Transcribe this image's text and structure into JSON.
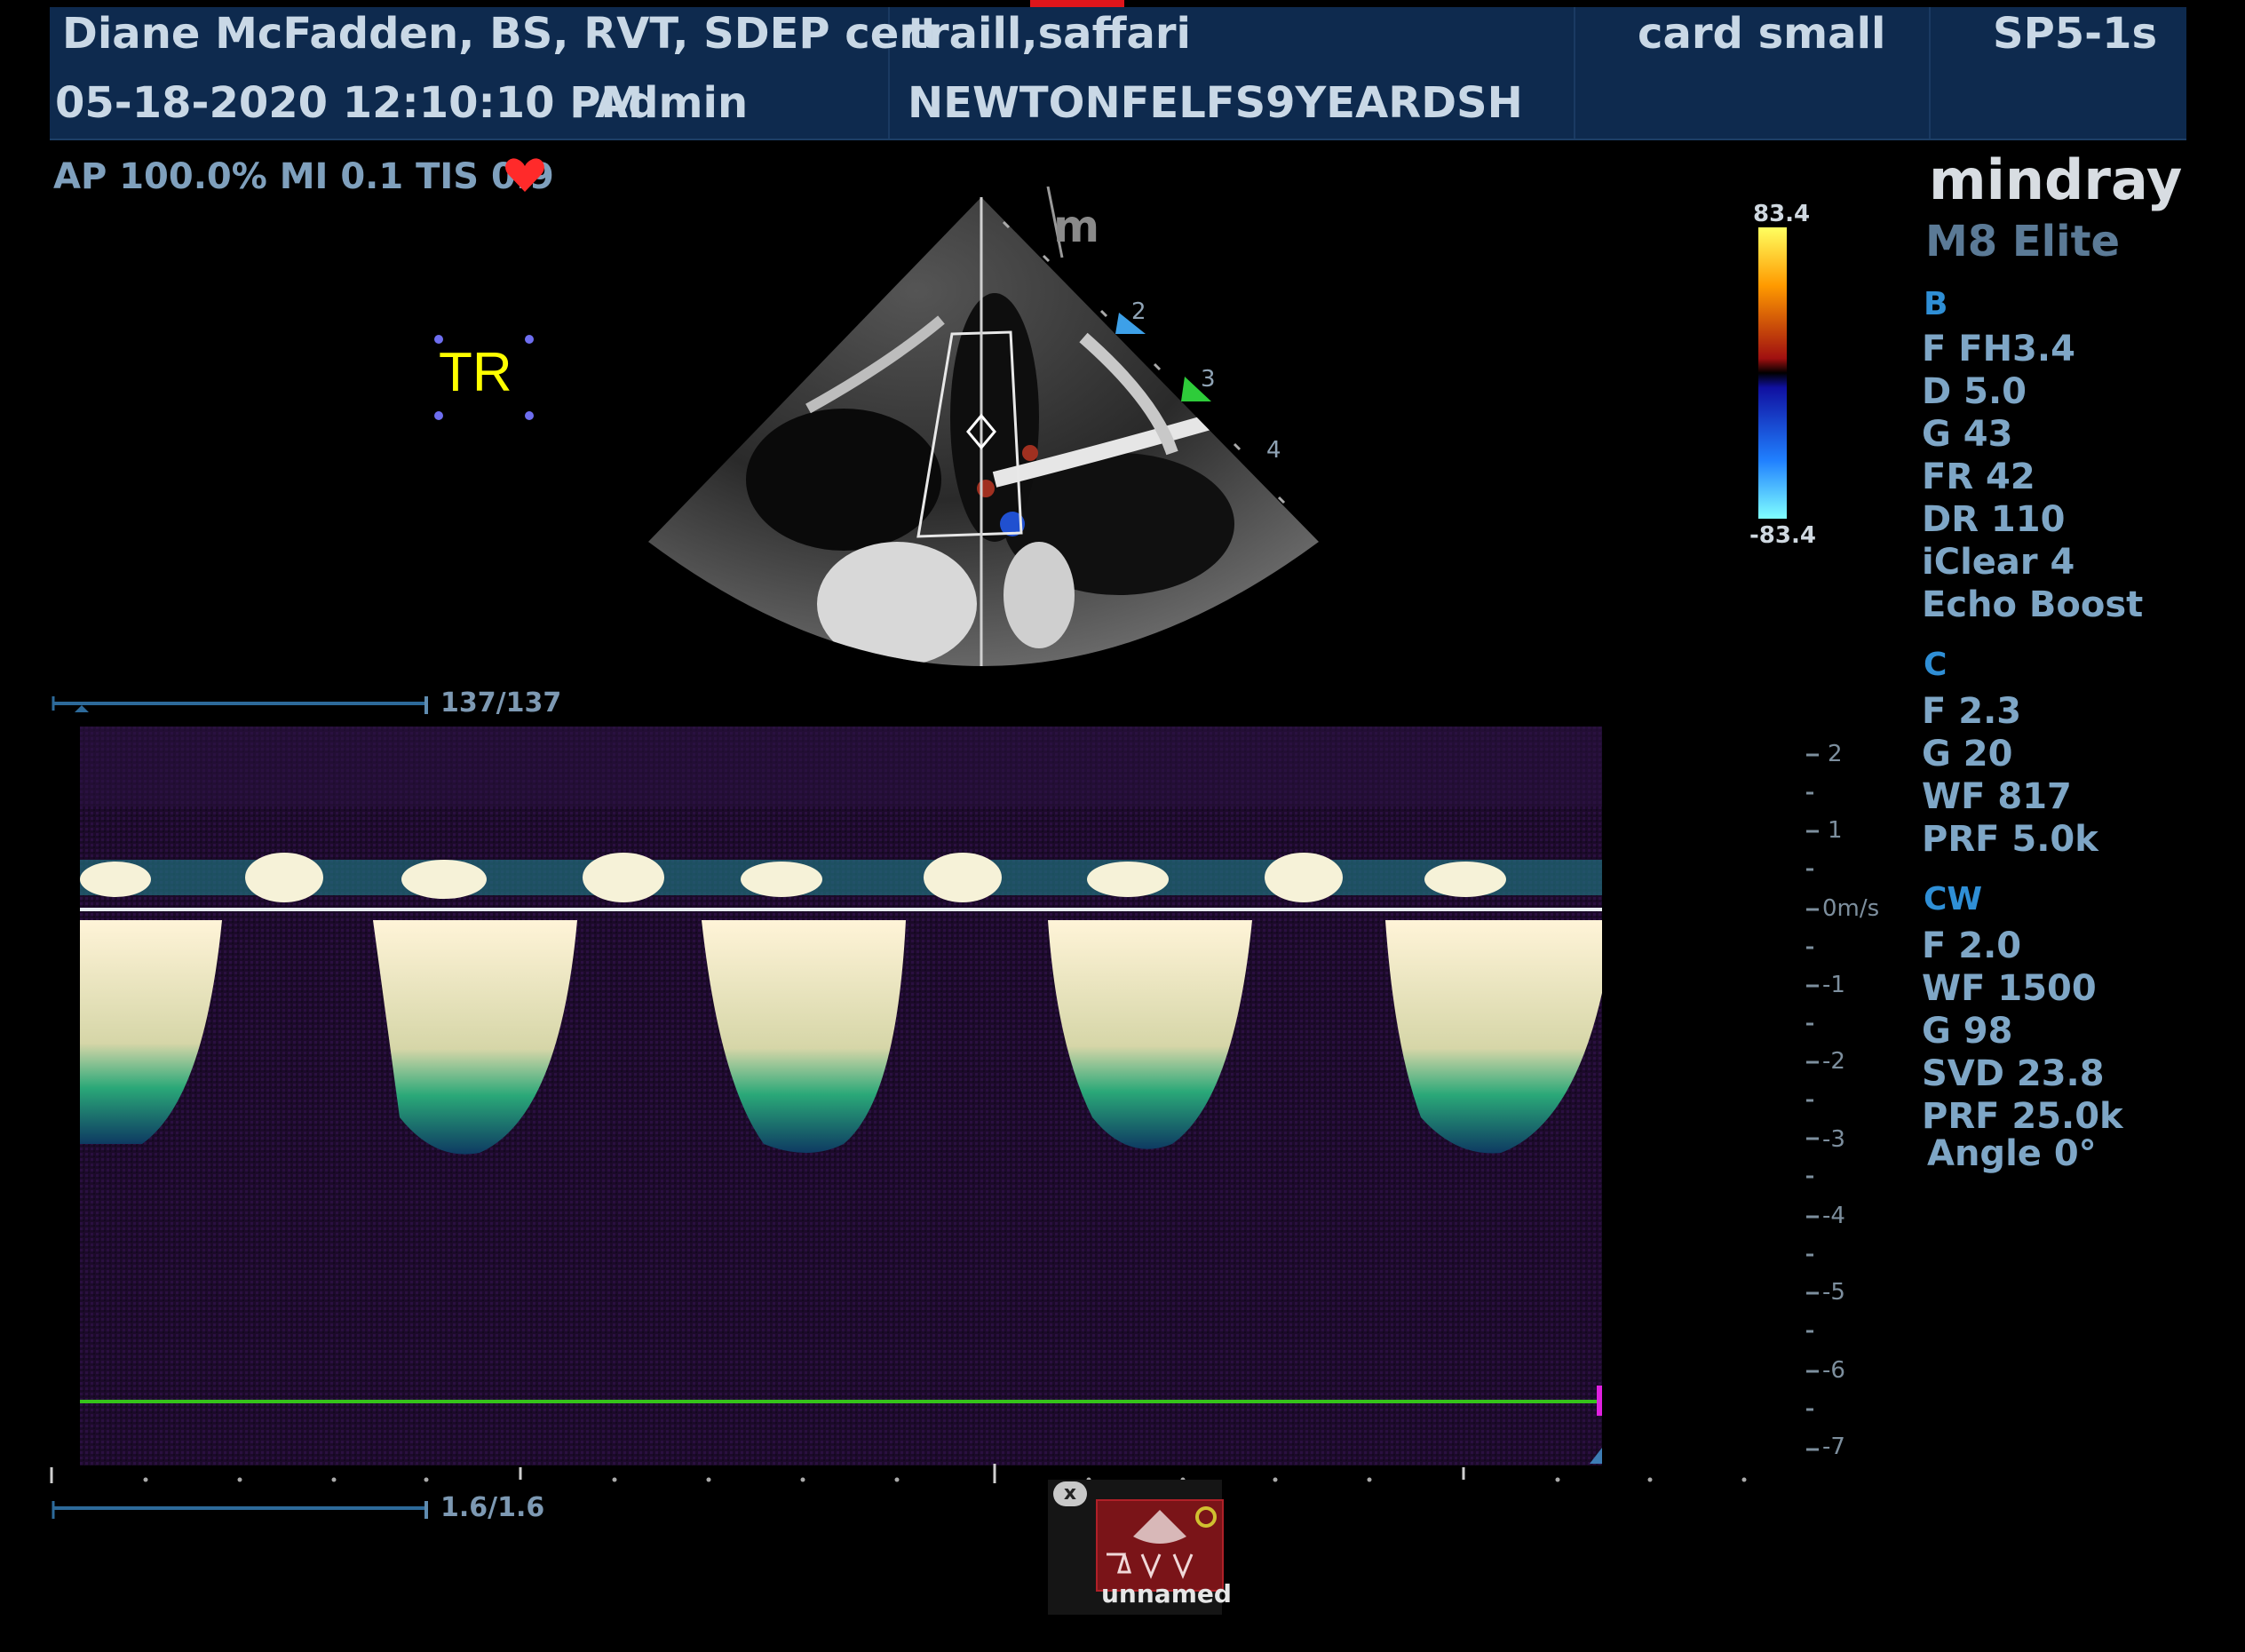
{
  "header": {
    "operator": "Diane McFadden, BS, RVT, SDEP cert",
    "datetime": "05-18-2020 12:10:10 PM",
    "user": "Admin",
    "patient_name": "traill,saffari",
    "patient_id": "NEWTONFELFS9YEARDSH",
    "preset": "card small",
    "probe": "SP5-1s"
  },
  "status_line": "AP 100.0%  MI 0.1 TIS 0.9",
  "annotation_text": "TR",
  "brand": {
    "logo": "mindray",
    "model": "M8 Elite"
  },
  "color_scale": {
    "max": "83.4",
    "min": "-83.4"
  },
  "sector_markers": [
    "2",
    "3",
    "4"
  ],
  "sector_depth_mark": "m",
  "params": {
    "b_header": "B",
    "b": [
      "F FH3.4",
      "D 5.0",
      "G 43",
      "FR 42",
      "DR 110",
      "iClear 4",
      "Echo Boost"
    ],
    "c_header": "C",
    "c": [
      "F 2.3",
      "G 20",
      "WF 817",
      "PRF 5.0k"
    ],
    "cw_header": "CW",
    "cw": [
      "F 2.0",
      "WF 1500",
      "G 98",
      "SVD 23.8",
      "PRF 25.0k",
      "Angle 0°"
    ]
  },
  "velocity_scale": {
    "unit_label": "0m/s",
    "positive": [
      "2",
      "1"
    ],
    "negative": [
      "-1",
      "-2",
      "-3",
      "-4",
      "-5",
      "-6",
      "-7"
    ]
  },
  "cine_frames": "137/137",
  "cine_time": "1.6/1.6",
  "thumbnail": {
    "label": "unnamed",
    "close": "x"
  },
  "colors": {
    "header_bg": "#0e2a4e",
    "param_text": "#7ea6c6",
    "annotation": "#ffff00",
    "heart": "#ff2a2a",
    "baseline_green": "#35c21a"
  }
}
